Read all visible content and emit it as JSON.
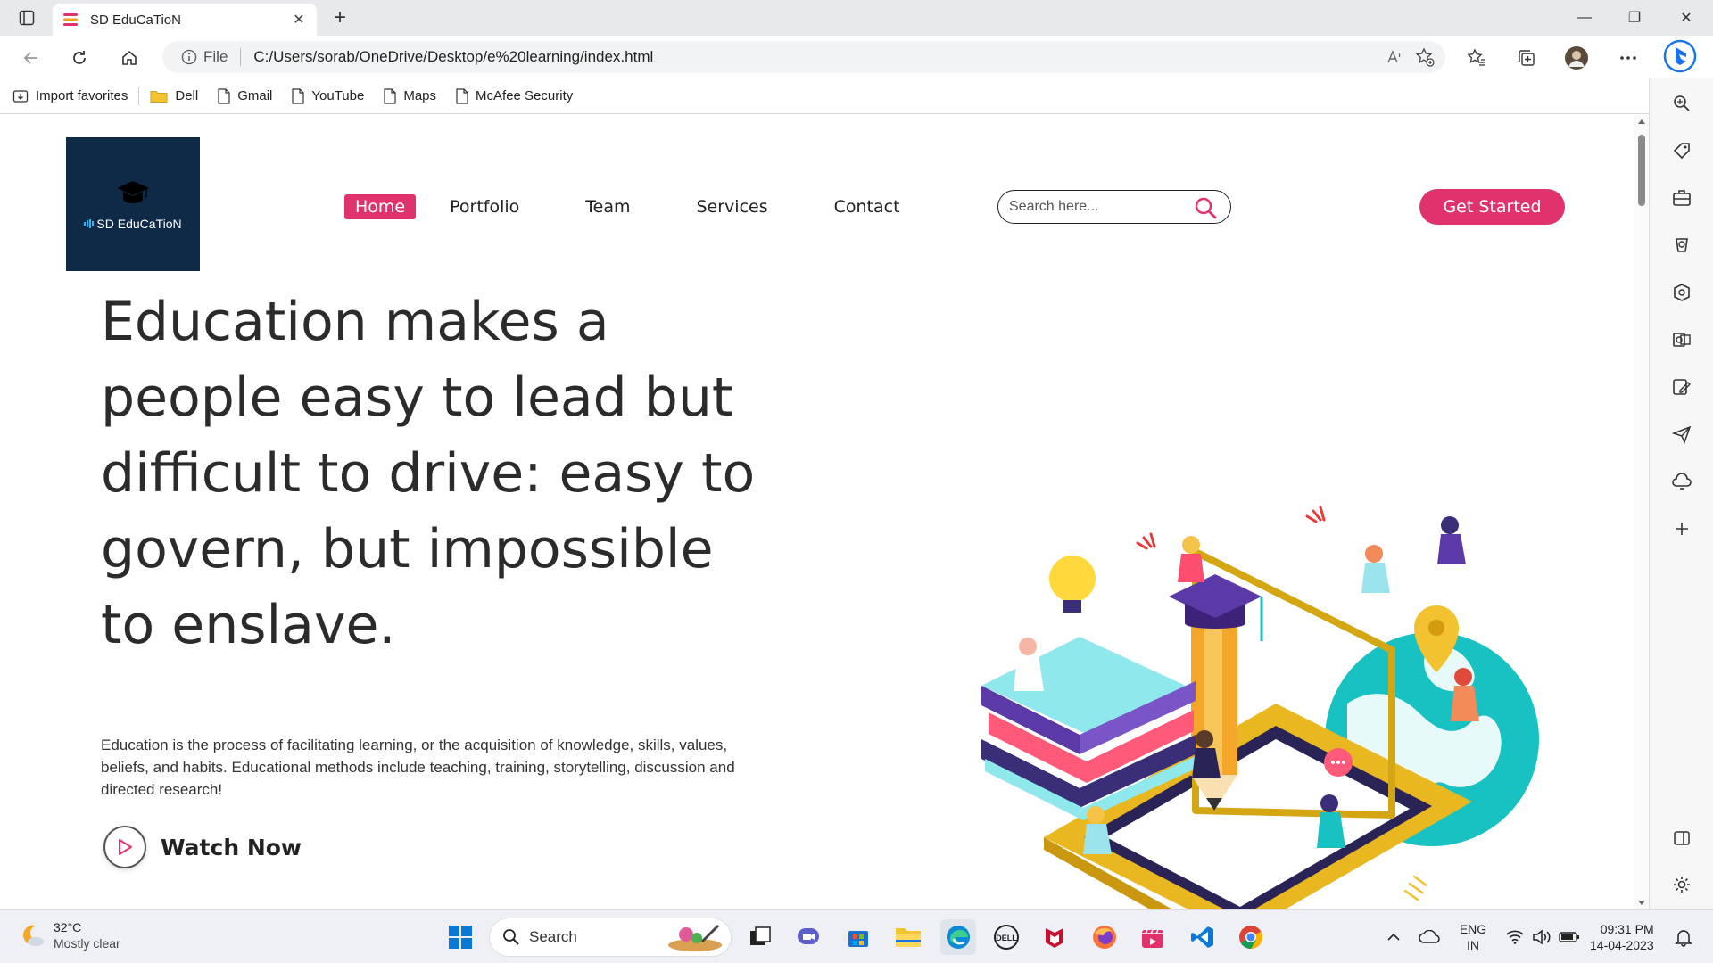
{
  "browser": {
    "tab_title": "SD EduCaTioN",
    "tab_close": "✕",
    "new_tab": "+",
    "window_minimize": "—",
    "window_restore": "❐",
    "window_close": "✕",
    "address_scheme": "File",
    "address_url": "C:/Users/sorab/OneDrive/Desktop/e%20learning/index.html"
  },
  "favorites": [
    {
      "label": "Import favorites",
      "icon": "import-icon"
    },
    {
      "label": "Dell",
      "icon": "folder-icon"
    },
    {
      "label": "Gmail",
      "icon": "page-icon"
    },
    {
      "label": "YouTube",
      "icon": "page-icon"
    },
    {
      "label": "Maps",
      "icon": "page-icon"
    },
    {
      "label": "McAfee Security",
      "icon": "page-icon"
    }
  ],
  "site": {
    "logo_text": "SD EduCaTioN",
    "nav": [
      "Home",
      "Portfolio",
      "Team",
      "Services",
      "Contact"
    ],
    "search_placeholder": "Search here...",
    "cta": "Get Started",
    "hero_title": "Education makes a people easy to lead but difficult to drive: easy to govern, but impossible to enslave.",
    "hero_description": "Education is the process of facilitating learning, or the acquisition of knowledge, skills, values, beliefs, and habits. Educational methods include teaching, training, storytelling, discussion and directed research!",
    "watch_now": "Watch Now",
    "accent_color": "#e0336d",
    "logo_bg": "#0f2a47"
  },
  "taskbar": {
    "weather_temp": "32°C",
    "weather_desc": "Mostly clear",
    "search_label": "Search",
    "lang_line1": "ENG",
    "lang_line2": "IN",
    "time": "09:31 PM",
    "date": "14-04-2023"
  }
}
